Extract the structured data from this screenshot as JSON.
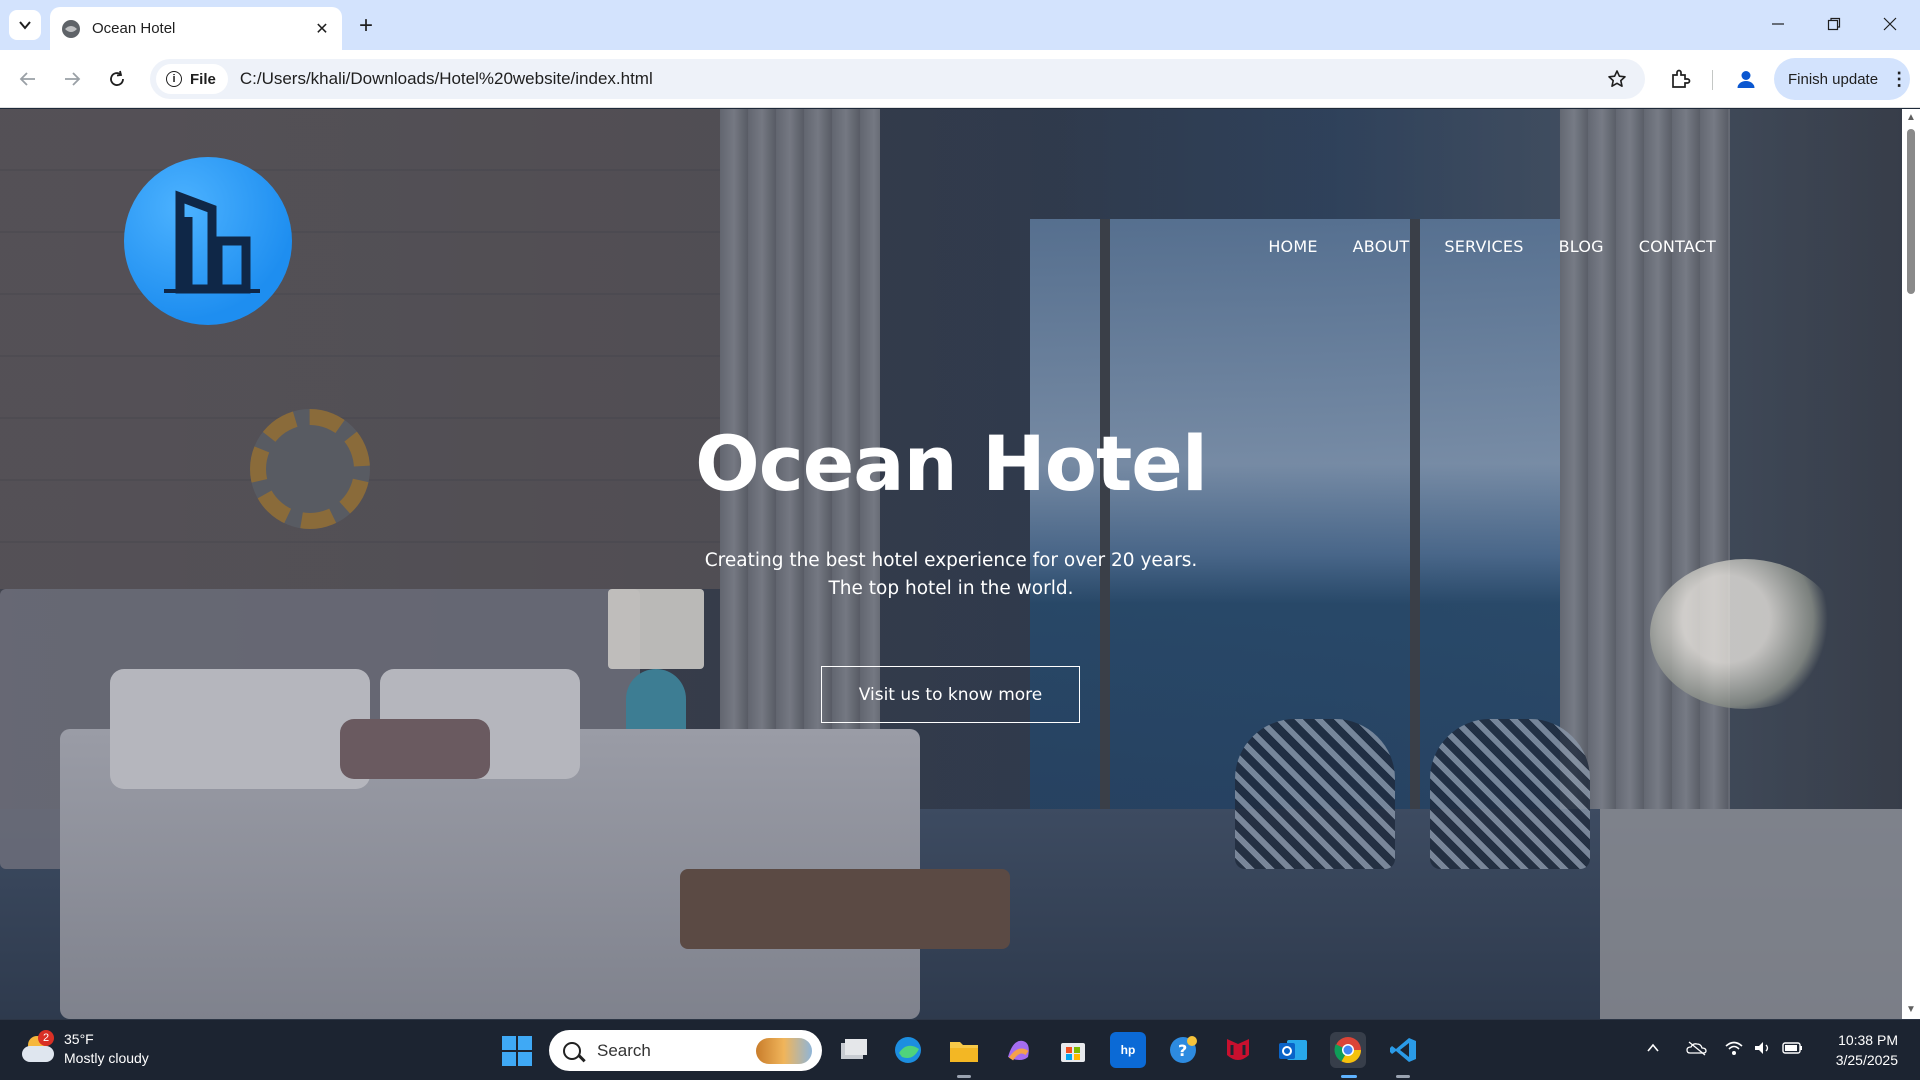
{
  "browser": {
    "tab_title": "Ocean Hotel",
    "new_tab_symbol": "+",
    "close_symbol": "✕",
    "chip_label": "File",
    "url": "C:/Users/khali/Downloads/Hotel%20website/index.html",
    "finish_update_label": "Finish update"
  },
  "site": {
    "nav": [
      "HOME",
      "ABOUT",
      "SERVICES",
      "BLOG",
      "CONTACT"
    ],
    "hero_title": "Ocean Hotel",
    "hero_line1": "Creating the best hotel experience for over 20 years.",
    "hero_line2": "The top hotel in the world.",
    "cta_label": "Visit us to know more",
    "logo_color": "#1e8ef0"
  },
  "taskbar": {
    "weather_temp": "35°F",
    "weather_desc": "Mostly cloudy",
    "weather_badge": "2",
    "search_placeholder": "Search",
    "time": "10:38 PM",
    "date": "3/25/2025"
  },
  "icons": [
    "tab-search-icon",
    "globe-icon",
    "back-icon",
    "forward-icon",
    "reload-icon",
    "info-icon",
    "star-icon",
    "extensions-icon",
    "profile-icon",
    "windows-start-icon",
    "search-icon",
    "wifi-icon",
    "volume-icon",
    "battery-icon"
  ]
}
